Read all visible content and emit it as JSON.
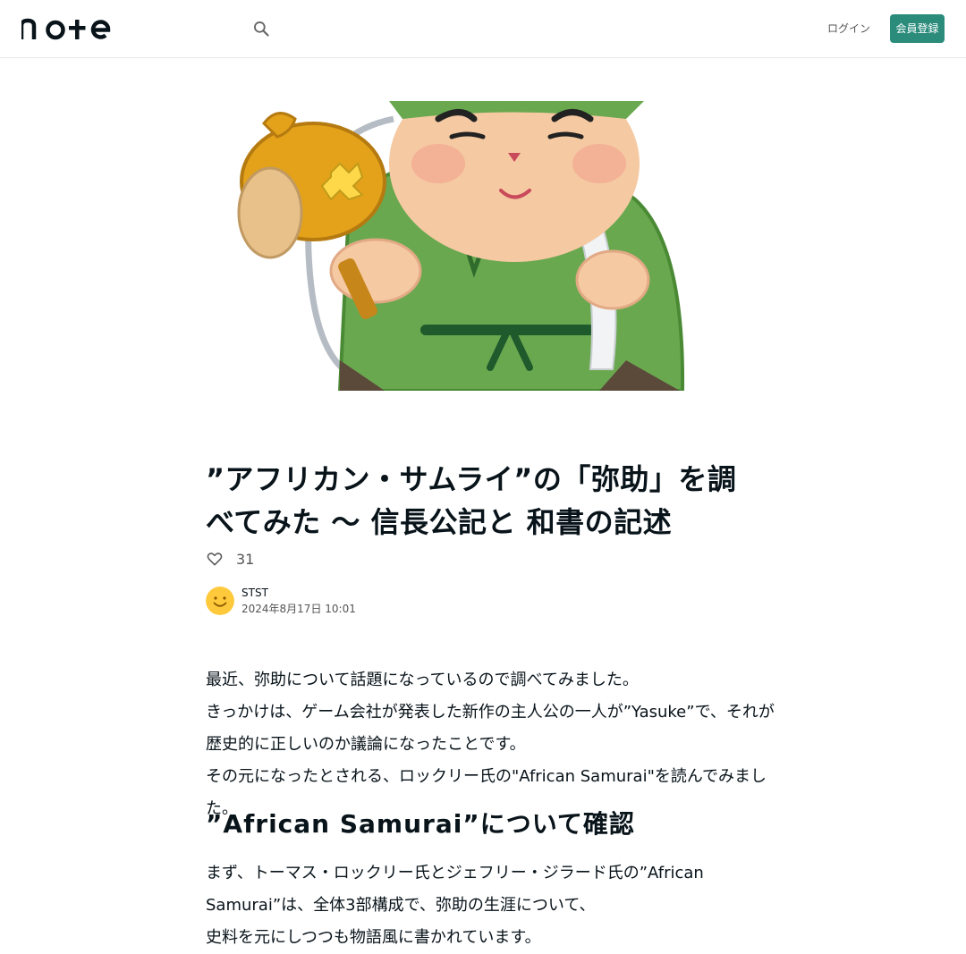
{
  "header": {
    "logo_text": "note",
    "login_label": "ログイン",
    "signup_label": "会員登録"
  },
  "icons": {
    "search": "search-icon",
    "heart": "heart-icon",
    "avatar": "smiley-avatar"
  },
  "article": {
    "title": "”アフリカン・サムライ”の「弥助」を調べてみた 〜 信長公記と 和書の記述",
    "likes": "31",
    "author_name": "STST",
    "date": "2024年8月17日 10:01",
    "intro_lines": [
      "最近、弥助について話題になっているので調べてみました。",
      "きっかけは、ゲーム会社が発表した新作の主人公の一人が”Yasuke”で、それが歴史的に正しいのか議論になったことです。",
      "その元になったとされる、ロックリー氏の\"African Samurai\"を読んでみました。"
    ],
    "section_heading": "”African Samurai”について確認",
    "section_lines": [
      "まず、トーマス・ロックリー氏とジェフリー・ジラード氏の”African Samurai”は、全体3部構成で、弥助の生涯について、",
      "史料を元にしつつも物語風に書かれています。"
    ]
  },
  "colors": {
    "accent": "#2b8c7c",
    "text": "#08131a",
    "muted": "#555555",
    "divider": "#e6e6e6"
  }
}
